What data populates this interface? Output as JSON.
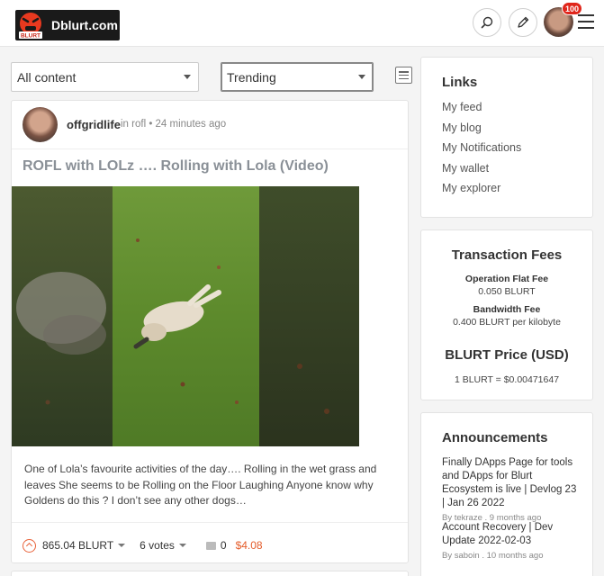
{
  "header": {
    "logo_text": "Dblurt.com",
    "logo_badge": "BLURT",
    "notification_count": "100"
  },
  "filters": {
    "content_filter": "All content",
    "sort_filter": "Trending"
  },
  "post": {
    "author": "offgridlife",
    "meta": "in rofl • 24 minutes ago",
    "title": "ROFL with LOLz …. Rolling with Lola (Video)",
    "excerpt": "One of Lola’s favourite activities of the day…. Rolling in the wet grass and leaves She seems to be Rolling on the Floor Laughing Anyone know why Goldens do this ? I don’t see any other dogs…",
    "value": "865.04 BLURT",
    "votes": "6 votes",
    "comments": "0",
    "payout": "$4.08"
  },
  "links": {
    "title": "Links",
    "items": [
      "My feed",
      "My blog",
      "My Notifications",
      "My wallet",
      "My explorer"
    ]
  },
  "fees": {
    "title": "Transaction Fees",
    "op_label": "Operation Flat Fee",
    "op_value": "0.050 BLURT",
    "bw_label": "Bandwidth Fee",
    "bw_value": "0.400 BLURT per kilobyte",
    "price_title": "BLURT Price (USD)",
    "price_value": "1 BLURT = $0.00471647"
  },
  "announcements": {
    "title": "Announcements",
    "items": [
      {
        "title": "Finally DApps Page for tools and DApps for Blurt Ecosystem is live | Devlog 23 | Jan 26 2022",
        "meta": "By tekraze . 9 months ago"
      },
      {
        "title": "Account Recovery | Dev Update 2022-02-03",
        "meta": "By saboin . 10 months ago"
      }
    ]
  },
  "colors": {
    "accent": "#e45c2a",
    "title_grey": "#8a9097",
    "badge_red": "#e0261b"
  }
}
